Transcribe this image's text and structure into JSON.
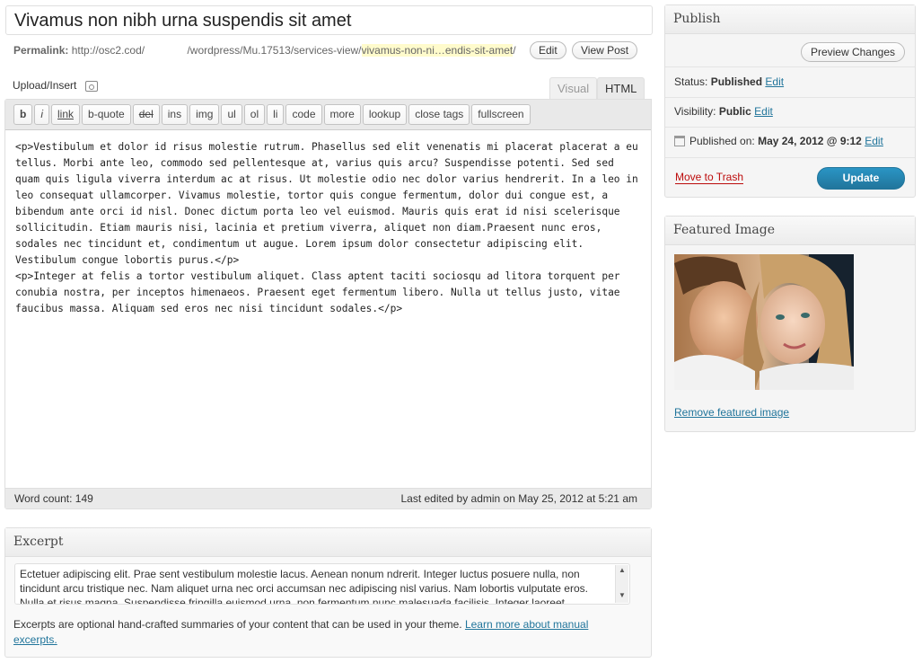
{
  "title": "Vivamus non nibh urna suspendis sit amet",
  "permalink": {
    "label": "Permalink:",
    "base": "http://osc2.cod/",
    "path": "/wordpress/Mu.17513/services-view/",
    "slug": "vivamus-non-ni…endis-sit-amet",
    "tail": "/",
    "edit_label": "Edit",
    "view_post_label": "View Post"
  },
  "upload_insert": "Upload/Insert",
  "tabs": {
    "visual": "Visual",
    "html": "HTML"
  },
  "quicktags": [
    "b",
    "i",
    "link",
    "b-quote",
    "del",
    "ins",
    "img",
    "ul",
    "ol",
    "li",
    "code",
    "more",
    "lookup",
    "close tags",
    "fullscreen"
  ],
  "content": "<p>Vestibulum et dolor id risus molestie rutrum. Phasellus sed elit venenatis mi placerat placerat a eu tellus. Morbi ante leo, commodo sed pellentesque at, varius quis arcu? Suspendisse potenti. Sed sed quam quis ligula viverra interdum ac at risus. Ut molestie odio nec dolor varius hendrerit. In a leo in leo consequat ullamcorper. Vivamus molestie, tortor quis congue fermentum, dolor dui congue est, a bibendum ante orci id nisl. Donec dictum porta leo vel euismod. Mauris quis erat id nisi scelerisque sollicitudin. Etiam mauris nisi, lacinia et pretium viverra, aliquet non diam.Praesent nunc eros, sodales nec tincidunt et, condimentum ut augue. Lorem ipsum dolor consectetur adipiscing elit. Vestibulum congue lobortis purus.</p>\n<p>Integer at felis a tortor vestibulum aliquet. Class aptent taciti sociosqu ad litora torquent per conubia nostra, per inceptos himenaeos. Praesent eget fermentum libero. Nulla ut tellus justo, vitae faucibus massa. Aliquam sed eros nec nisi tincidunt sodales.</p>",
  "status_bar": {
    "word_count": "Word count: 149",
    "last_edited": "Last edited by admin on May 25, 2012 at 5:21 am"
  },
  "excerpt": {
    "heading": "Excerpt",
    "text": "Ectetuer adipiscing elit. Prae sent vestibulum molestie lacus. Aenean nonum ndrerit. Integer luctus posuere nulla, non tincidunt arcu tristique nec. Nam aliquet urna nec orci accumsan nec adipiscing nisl varius. Nam lobortis vulputate eros. Nulla et risus magna. Suspendisse fringilla euismod urna, non fermentum nunc malesuada facilisis. Integer laoreet",
    "help": "Excerpts are optional hand-crafted summaries of your content that can be used in your theme.",
    "help_link": "Learn more about manual excerpts."
  },
  "publish": {
    "heading": "Publish",
    "preview_label": "Preview Changes",
    "status_label": "Status:",
    "status_value": "Published",
    "visibility_label": "Visibility:",
    "visibility_value": "Public",
    "published_label": "Published on:",
    "published_value": "May 24, 2012 @ 9:12",
    "edit_label": "Edit",
    "trash_label": "Move to Trash",
    "update_label": "Update"
  },
  "featured": {
    "heading": "Featured Image",
    "remove_label": "Remove featured image"
  },
  "colors": {
    "accent": "#21759b",
    "trash": "#bc0b0b",
    "slug_highlight": "#fffbcc"
  }
}
